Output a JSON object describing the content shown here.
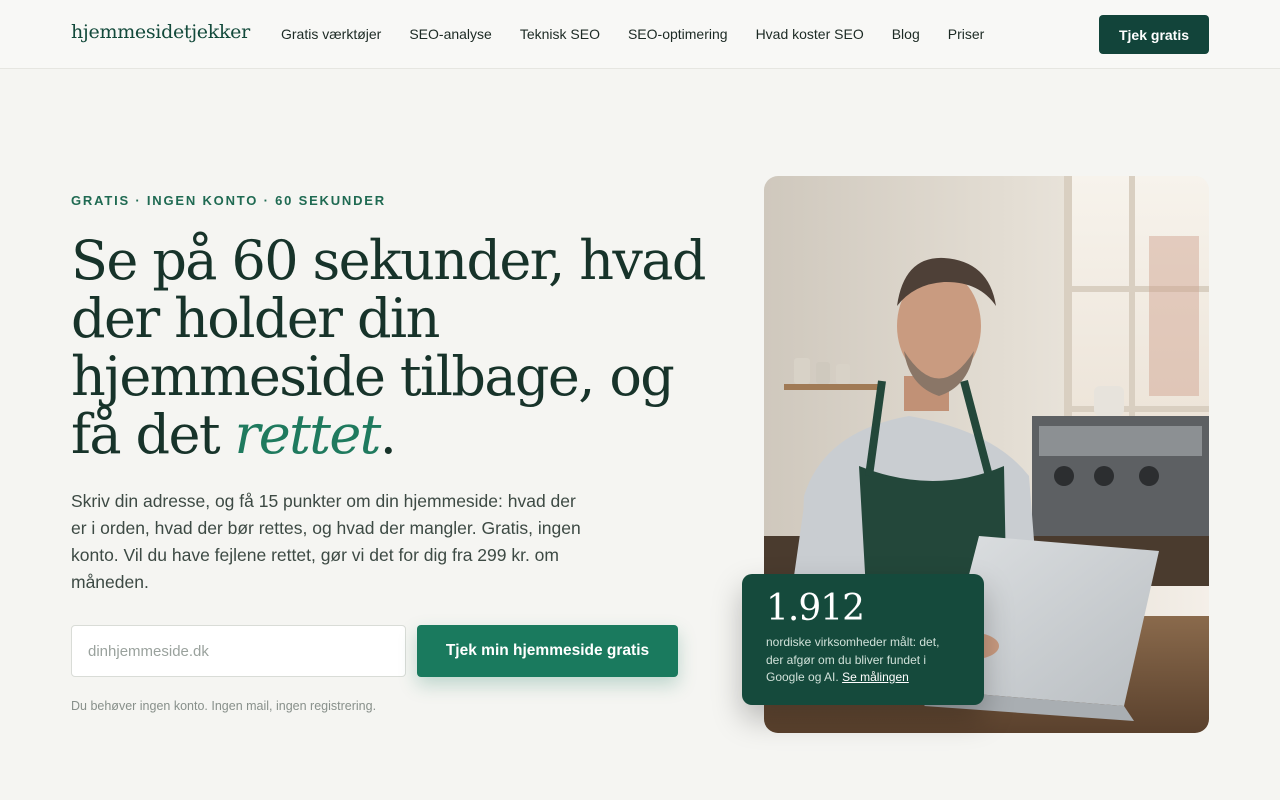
{
  "brand": {
    "logo": "hjemmesidetjekker"
  },
  "nav": {
    "items": [
      "Gratis værktøjer",
      "SEO-analyse",
      "Teknisk SEO",
      "SEO-optimering",
      "Hvad koster SEO",
      "Blog",
      "Priser"
    ],
    "cta_label": "Tjek gratis"
  },
  "hero": {
    "eyebrow": "GRATIS · INGEN KONTO · 60 SEKUNDER",
    "headline_part1": "Se på 60 sekunder, hvad der holder din hjemmeside tilbage, og få det ",
    "headline_accent": "rettet",
    "headline_end": ".",
    "lead": "Skriv din adresse, og få 15 punkter om din hjemmeside: hvad der er i orden, hvad der bør rettes, og hvad der mangler. Gratis, ingen konto. Vil du have fejlene rettet, gør vi det for dig fra 299 kr. om måneden.",
    "input_placeholder": "dinhjemmeside.dk",
    "input_value": "",
    "submit_label": "Tjek min hjemmeside gratis",
    "note": "Du behøver ingen konto. Ingen mail, ingen registrering."
  },
  "stat": {
    "number": "1.912",
    "text": "nordiske virksomheder målt: det, der afgør om du bliver fundet i Google og AI.",
    "link": "Se målingen"
  },
  "colors": {
    "brand_dark": "#12443a",
    "brand_green": "#1a7a5e",
    "background": "#f5f5f2"
  }
}
